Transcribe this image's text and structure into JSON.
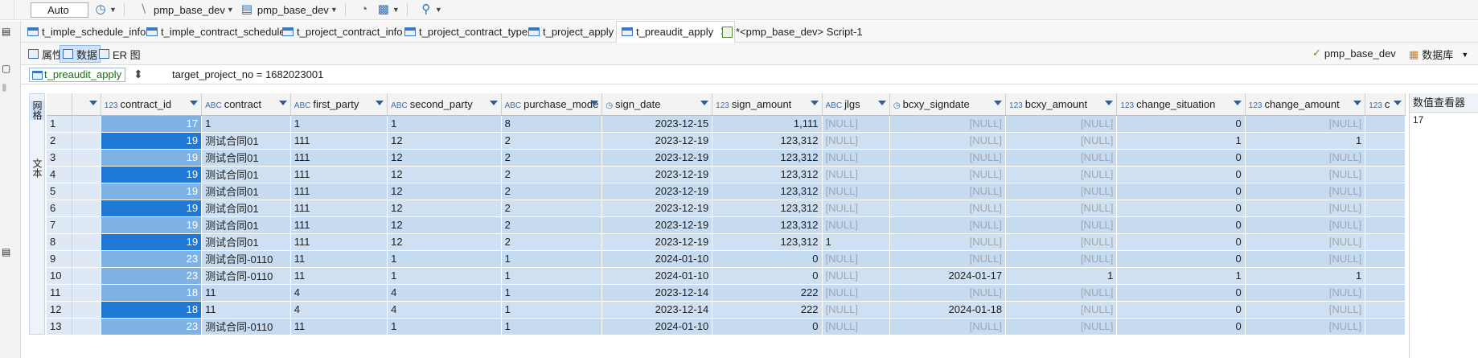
{
  "toolbar": {
    "auto_label": "Auto",
    "connection1": "pmp_base_dev",
    "connection2": "pmp_base_dev"
  },
  "tabs": [
    {
      "label": "t_imple_schedule_info"
    },
    {
      "label": "t_imple_contract_schedule"
    },
    {
      "label": "t_project_contract_info"
    },
    {
      "label": "t_project_contract_type"
    },
    {
      "label": "t_project_apply"
    },
    {
      "label": "t_preaudit_apply"
    },
    {
      "label": "*<pmp_base_dev> Script-1"
    }
  ],
  "subbar": {
    "properties": "属性",
    "data": "数据",
    "er": "ER 图",
    "datasource": "pmp_base_dev",
    "database": "数据库"
  },
  "filter": {
    "table": "t_preaudit_apply",
    "expression": "target_project_no = 1682023001"
  },
  "sidetabs": {
    "grid": "网格",
    "text": "文本"
  },
  "columns": [
    {
      "type": "123",
      "name": "contract_id"
    },
    {
      "type": "ABC",
      "name": "contract"
    },
    {
      "type": "ABC",
      "name": "first_party"
    },
    {
      "type": "ABC",
      "name": "second_party"
    },
    {
      "type": "ABC",
      "name": "purchase_mode"
    },
    {
      "type": "clock",
      "name": "sign_date"
    },
    {
      "type": "123",
      "name": "sign_amount"
    },
    {
      "type": "ABC",
      "name": "jlgs"
    },
    {
      "type": "clock",
      "name": "bcxy_signdate"
    },
    {
      "type": "123",
      "name": "bcxy_amount"
    },
    {
      "type": "123",
      "name": "change_situation"
    },
    {
      "type": "123",
      "name": "change_amount"
    },
    {
      "type": "123",
      "name": "c"
    }
  ],
  "rows": [
    [
      "1",
      "17",
      "1",
      "1",
      "1",
      "8",
      "2023-12-15",
      "1,111",
      "[NULL]",
      "[NULL]",
      "[NULL]",
      "0",
      "[NULL]"
    ],
    [
      "2",
      "19",
      "测试合同01",
      "111",
      "12",
      "2",
      "2023-12-19",
      "123,312",
      "[NULL]",
      "[NULL]",
      "[NULL]",
      "1",
      "1"
    ],
    [
      "3",
      "19",
      "测试合同01",
      "111",
      "12",
      "2",
      "2023-12-19",
      "123,312",
      "[NULL]",
      "[NULL]",
      "[NULL]",
      "0",
      "[NULL]"
    ],
    [
      "4",
      "19",
      "测试合同01",
      "111",
      "12",
      "2",
      "2023-12-19",
      "123,312",
      "[NULL]",
      "[NULL]",
      "[NULL]",
      "0",
      "[NULL]"
    ],
    [
      "5",
      "19",
      "测试合同01",
      "111",
      "12",
      "2",
      "2023-12-19",
      "123,312",
      "[NULL]",
      "[NULL]",
      "[NULL]",
      "0",
      "[NULL]"
    ],
    [
      "6",
      "19",
      "测试合同01",
      "111",
      "12",
      "2",
      "2023-12-19",
      "123,312",
      "[NULL]",
      "[NULL]",
      "[NULL]",
      "0",
      "[NULL]"
    ],
    [
      "7",
      "19",
      "测试合同01",
      "111",
      "12",
      "2",
      "2023-12-19",
      "123,312",
      "[NULL]",
      "[NULL]",
      "[NULL]",
      "0",
      "[NULL]"
    ],
    [
      "8",
      "19",
      "测试合同01",
      "111",
      "12",
      "2",
      "2023-12-19",
      "123,312",
      "1",
      "[NULL]",
      "[NULL]",
      "0",
      "[NULL]"
    ],
    [
      "9",
      "23",
      "测试合同-0110",
      "11",
      "1",
      "1",
      "2024-01-10",
      "0",
      "[NULL]",
      "[NULL]",
      "[NULL]",
      "0",
      "[NULL]"
    ],
    [
      "10",
      "23",
      "测试合同-0110",
      "11",
      "1",
      "1",
      "2024-01-10",
      "0",
      "[NULL]",
      "2024-01-17",
      "1",
      "1",
      "1"
    ],
    [
      "11",
      "18",
      "11",
      "4",
      "4",
      "1",
      "2023-12-14",
      "222",
      "[NULL]",
      "[NULL]",
      "[NULL]",
      "0",
      "[NULL]"
    ],
    [
      "12",
      "18",
      "11",
      "4",
      "4",
      "1",
      "2023-12-14",
      "222",
      "[NULL]",
      "2024-01-18",
      "[NULL]",
      "0",
      "[NULL]"
    ],
    [
      "13",
      "23",
      "测试合同-0110",
      "11",
      "1",
      "1",
      "2024-01-10",
      "0",
      "[NULL]",
      "[NULL]",
      "[NULL]",
      "0",
      "[NULL]"
    ]
  ],
  "value_panel": {
    "title": "数值查看器",
    "value": "17"
  }
}
